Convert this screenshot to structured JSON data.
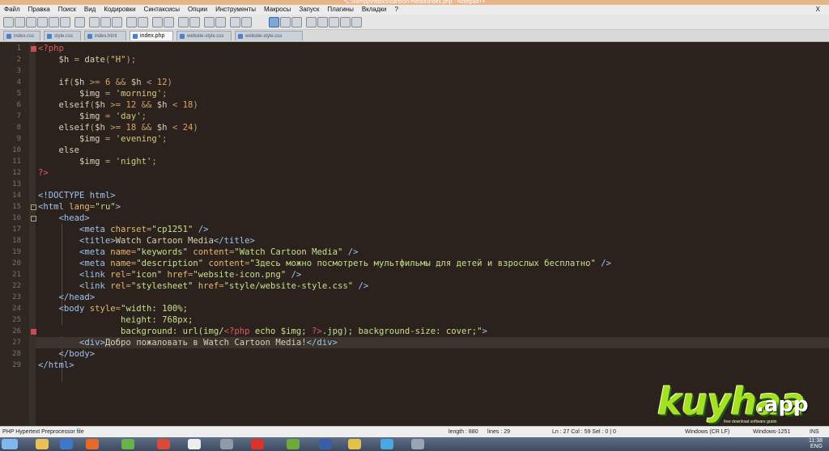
{
  "window": {
    "title": "*C:\\xampp\\htdocs\\cartoon-media\\index.php - Notepad++"
  },
  "menu": [
    "Файл",
    "Правка",
    "Поиск",
    "Вид",
    "Кодировки",
    "Синтаксисы",
    "Опции",
    "Инструменты",
    "Макросы",
    "Запуск",
    "Плагины",
    "Вкладки",
    "?"
  ],
  "menu_close": "X",
  "tabs": [
    {
      "label": "index.css",
      "active": false
    },
    {
      "label": "style.css",
      "active": false
    },
    {
      "label": "index.html",
      "active": false
    },
    {
      "label": "index.php",
      "active": true
    },
    {
      "label": "website-style.css",
      "active": false
    },
    {
      "label": "website-style.css",
      "active": false
    }
  ],
  "editor": {
    "current_line": 27,
    "lines": [
      {
        "n": "1",
        "fold": "open-red",
        "tokens": [
          [
            "php",
            "<?php"
          ]
        ]
      },
      {
        "n": "2",
        "tokens": [
          [
            "var",
            "    $h"
          ],
          [
            "op",
            " = "
          ],
          [
            "kw",
            "date"
          ],
          [
            "op",
            "("
          ],
          [
            "str",
            "\"H\""
          ],
          [
            "op",
            ");"
          ]
        ]
      },
      {
        "n": "3",
        "tokens": []
      },
      {
        "n": "4",
        "tokens": [
          [
            "kw",
            "    if"
          ],
          [
            "op",
            "("
          ],
          [
            "var",
            "$h"
          ],
          [
            "op",
            " >= "
          ],
          [
            "num",
            "6"
          ],
          [
            "op",
            " && "
          ],
          [
            "var",
            "$h"
          ],
          [
            "op",
            " < "
          ],
          [
            "num",
            "12"
          ],
          [
            "op",
            ")"
          ]
        ]
      },
      {
        "n": "5",
        "tokens": [
          [
            "var",
            "        $img"
          ],
          [
            "op",
            " = "
          ],
          [
            "str",
            "'morning'"
          ],
          [
            "op",
            ";"
          ]
        ]
      },
      {
        "n": "6",
        "tokens": [
          [
            "kw",
            "    elseif"
          ],
          [
            "op",
            "("
          ],
          [
            "var",
            "$h"
          ],
          [
            "op",
            " >= "
          ],
          [
            "num",
            "12"
          ],
          [
            "op",
            " && "
          ],
          [
            "var",
            "$h"
          ],
          [
            "op",
            " < "
          ],
          [
            "num",
            "18"
          ],
          [
            "op",
            ")"
          ]
        ]
      },
      {
        "n": "7",
        "tokens": [
          [
            "var",
            "        $img"
          ],
          [
            "op",
            " = "
          ],
          [
            "str",
            "'day'"
          ],
          [
            "op",
            ";"
          ]
        ]
      },
      {
        "n": "8",
        "tokens": [
          [
            "kw",
            "    elseif"
          ],
          [
            "op",
            "("
          ],
          [
            "var",
            "$h"
          ],
          [
            "op",
            " >= "
          ],
          [
            "num",
            "18"
          ],
          [
            "op",
            " && "
          ],
          [
            "var",
            "$h"
          ],
          [
            "op",
            " < "
          ],
          [
            "num",
            "24"
          ],
          [
            "op",
            ")"
          ]
        ]
      },
      {
        "n": "9",
        "tokens": [
          [
            "var",
            "        $img"
          ],
          [
            "op",
            " = "
          ],
          [
            "str",
            "'evening'"
          ],
          [
            "op",
            ";"
          ]
        ]
      },
      {
        "n": "10",
        "tokens": [
          [
            "kw",
            "    else"
          ]
        ]
      },
      {
        "n": "11",
        "tokens": [
          [
            "var",
            "        $img"
          ],
          [
            "op",
            " = "
          ],
          [
            "str",
            "'night'"
          ],
          [
            "op",
            ";"
          ]
        ]
      },
      {
        "n": "12",
        "tokens": [
          [
            "php",
            "?>"
          ]
        ]
      },
      {
        "n": "13",
        "tokens": []
      },
      {
        "n": "14",
        "tokens": [
          [
            "tag",
            "<!DOCTYPE html>"
          ]
        ]
      },
      {
        "n": "15",
        "fold": "open",
        "tokens": [
          [
            "tag",
            "<html "
          ],
          [
            "attr",
            "lang"
          ],
          [
            "op",
            "="
          ],
          [
            "val",
            "\"ru\""
          ],
          [
            "tag",
            ">"
          ]
        ]
      },
      {
        "n": "16",
        "fold": "open",
        "tokens": [
          [
            "tag",
            "    <head>"
          ]
        ]
      },
      {
        "n": "17",
        "tokens": [
          [
            "tag",
            "        <meta "
          ],
          [
            "attr",
            "charset"
          ],
          [
            "op",
            "="
          ],
          [
            "val",
            "\"cp1251\""
          ],
          [
            "tag",
            " />"
          ]
        ]
      },
      {
        "n": "18",
        "tokens": [
          [
            "tag",
            "        <title>"
          ],
          [
            "txt",
            "Watch Cartoon Media"
          ],
          [
            "tag",
            "</title>"
          ]
        ]
      },
      {
        "n": "19",
        "tokens": [
          [
            "tag",
            "        <meta "
          ],
          [
            "attr",
            "name"
          ],
          [
            "op",
            "="
          ],
          [
            "val",
            "\"keywords\""
          ],
          [
            "attr",
            " content"
          ],
          [
            "op",
            "="
          ],
          [
            "val",
            "\"Watch Cartoon Media\""
          ],
          [
            "tag",
            " />"
          ]
        ]
      },
      {
        "n": "20",
        "tokens": [
          [
            "tag",
            "        <meta "
          ],
          [
            "attr",
            "name"
          ],
          [
            "op",
            "="
          ],
          [
            "val",
            "\"description\""
          ],
          [
            "attr",
            " content"
          ],
          [
            "op",
            "="
          ],
          [
            "val",
            "\"Здесь можно посмотреть мультфильмы для детей и взрослых бесплатно\""
          ],
          [
            "tag",
            " />"
          ]
        ]
      },
      {
        "n": "21",
        "tokens": [
          [
            "tag",
            "        <link "
          ],
          [
            "attr",
            "rel"
          ],
          [
            "op",
            "="
          ],
          [
            "val",
            "\"icon\""
          ],
          [
            "attr",
            " href"
          ],
          [
            "op",
            "="
          ],
          [
            "val",
            "\"website-icon.png\""
          ],
          [
            "tag",
            " />"
          ]
        ]
      },
      {
        "n": "22",
        "tokens": [
          [
            "tag",
            "        <link "
          ],
          [
            "attr",
            "rel"
          ],
          [
            "op",
            "="
          ],
          [
            "val",
            "\"stylesheet\""
          ],
          [
            "attr",
            " href"
          ],
          [
            "op",
            "="
          ],
          [
            "val",
            "\"style/website-style.css\""
          ],
          [
            "tag",
            " />"
          ]
        ]
      },
      {
        "n": "23",
        "tokens": [
          [
            "tag",
            "    </head>"
          ]
        ]
      },
      {
        "n": "24",
        "tokens": [
          [
            "tag",
            "    <body "
          ],
          [
            "attr",
            "style"
          ],
          [
            "op",
            "="
          ],
          [
            "val",
            "\"width: 100%;"
          ]
        ]
      },
      {
        "n": "25",
        "tokens": [
          [
            "val",
            "                height: 768px;"
          ]
        ]
      },
      {
        "n": "26",
        "fold": "red",
        "tokens": [
          [
            "val",
            "                background: url(img/"
          ],
          [
            "php",
            "<?php"
          ],
          [
            "val",
            " echo $img; "
          ],
          [
            "php",
            "?>"
          ],
          [
            "val",
            ".jpg); background-size: cover;\""
          ],
          [
            "tag",
            ">"
          ]
        ]
      },
      {
        "n": "27",
        "tokens": [
          [
            "tag",
            "        <div>"
          ],
          [
            "txt",
            "Добро пожаловать в Watch Cartoon Media!"
          ],
          [
            "tag",
            "</div>"
          ]
        ]
      },
      {
        "n": "28",
        "tokens": [
          [
            "tag",
            "    </body>"
          ]
        ]
      },
      {
        "n": "29",
        "tokens": [
          [
            "tag",
            "</html>"
          ]
        ]
      }
    ]
  },
  "status": {
    "filetype": "PHP Hypertext Preprocessor file",
    "length": "length : 880",
    "lines": "lines : 29",
    "position": "Ln : 27   Col : 59   Sel : 0 | 0",
    "eol": "Windows (CR LF)",
    "encoding": "Windows-1251",
    "mode": "INS"
  },
  "taskbar": {
    "lang": "ENG",
    "time": "11:38",
    "apps": [
      "windows-start-icon",
      "folder-icon",
      "word-icon",
      "media-icon",
      "chrome-icon",
      "yandex-icon",
      "editor-icon",
      "opera-icon",
      "utorrent-icon",
      "photoshop-icon",
      "app-icon",
      "skype-icon",
      "notepad-icon"
    ]
  },
  "watermark": {
    "brand": "kuyhaa",
    "tld": ".app",
    "tagline": "free download software gratis"
  },
  "colors": {
    "editor_bg": "#2b221d",
    "tag": "#9bc4f2",
    "string": "#d8c97a",
    "php_tag": "#e05860",
    "watermark": "#a6e022"
  }
}
